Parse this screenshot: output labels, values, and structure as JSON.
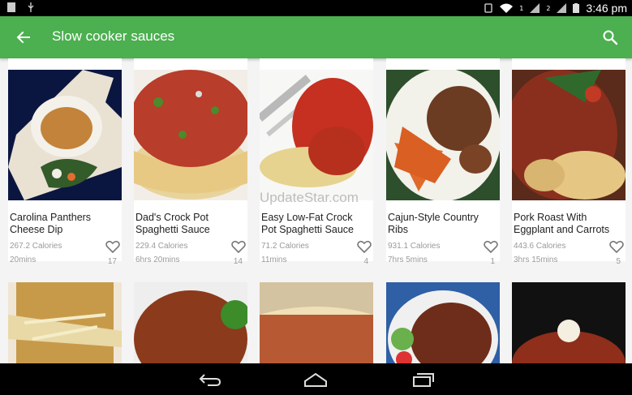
{
  "status_bar": {
    "time": "3:46 pm",
    "left_icons": [
      "notification-icon",
      "usb-icon"
    ],
    "right_icons": [
      "rotation-icon",
      "wifi-icon",
      "signal-icon",
      "signal-icon",
      "battery-icon"
    ],
    "signal_labels": [
      "1",
      "2"
    ]
  },
  "toolbar": {
    "title": "Slow cooker sauces",
    "back_icon": "arrow-back-icon",
    "search_icon": "search-icon",
    "color": "#4caf50"
  },
  "recipes": [
    {
      "name": "Carolina Panthers Cheese Dip",
      "calories": "267.2 Calories",
      "time": "20mins",
      "likes": "17"
    },
    {
      "name": "Dad's Crock Pot Spaghetti Sauce",
      "calories": "229.4 Calories",
      "time": "6hrs 20mins",
      "likes": "14"
    },
    {
      "name": "Easy Low-Fat Crock Pot Spaghetti Sauce",
      "calories": "71.2 Calories",
      "time": "11mins",
      "likes": "4"
    },
    {
      "name": "Cajun-Style Country Ribs",
      "calories": "931.1 Calories",
      "time": "7hrs 5mins",
      "likes": "1"
    },
    {
      "name": "Pork Roast With Eggplant and Carrots",
      "calories": "443.6 Calories",
      "time": "3hrs 15mins",
      "likes": "5"
    }
  ],
  "watermark": "UpdateStar.com",
  "nav_bar": {
    "icons": [
      "back-nav-icon",
      "home-icon",
      "recents-icon"
    ]
  }
}
